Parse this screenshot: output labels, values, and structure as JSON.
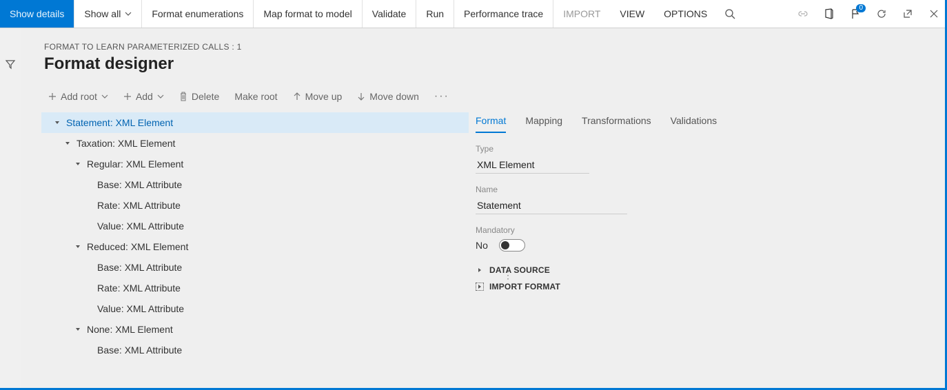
{
  "menubar": {
    "show_details": "Show details",
    "show_all": "Show all",
    "format_enum": "Format enumerations",
    "map_format": "Map format to model",
    "validate": "Validate",
    "run": "Run",
    "perf_trace": "Performance trace",
    "import": "IMPORT",
    "view": "VIEW",
    "options": "OPTIONS",
    "badge_count": "0"
  },
  "breadcrumb": "FORMAT TO LEARN PARAMETERIZED CALLS : 1",
  "page_title": "Format designer",
  "toolbar": {
    "add_root": "Add root",
    "add": "Add",
    "delete": "Delete",
    "make_root": "Make root",
    "move_up": "Move up",
    "move_down": "Move down"
  },
  "tree": [
    {
      "level": 0,
      "expanded": true,
      "selected": true,
      "label": "Statement: XML Element"
    },
    {
      "level": 1,
      "expanded": true,
      "selected": false,
      "label": "Taxation: XML Element"
    },
    {
      "level": 2,
      "expanded": true,
      "selected": false,
      "label": "Regular: XML Element"
    },
    {
      "level": 3,
      "expanded": false,
      "selected": false,
      "label": "Base: XML Attribute"
    },
    {
      "level": 3,
      "expanded": false,
      "selected": false,
      "label": "Rate: XML Attribute"
    },
    {
      "level": 3,
      "expanded": false,
      "selected": false,
      "label": "Value: XML Attribute"
    },
    {
      "level": 2,
      "expanded": true,
      "selected": false,
      "label": "Reduced: XML Element"
    },
    {
      "level": 3,
      "expanded": false,
      "selected": false,
      "label": "Base: XML Attribute"
    },
    {
      "level": 3,
      "expanded": false,
      "selected": false,
      "label": "Rate: XML Attribute"
    },
    {
      "level": 3,
      "expanded": false,
      "selected": false,
      "label": "Value: XML Attribute"
    },
    {
      "level": 2,
      "expanded": true,
      "selected": false,
      "label": "None: XML Element"
    },
    {
      "level": 3,
      "expanded": false,
      "selected": false,
      "label": "Base: XML Attribute"
    }
  ],
  "tabs": {
    "format": "Format",
    "mapping": "Mapping",
    "transformations": "Transformations",
    "validations": "Validations"
  },
  "props": {
    "type_label": "Type",
    "type_value": "XML Element",
    "name_label": "Name",
    "name_value": "Statement",
    "mandatory_label": "Mandatory",
    "mandatory_value": "No",
    "data_source": "DATA SOURCE",
    "import_format": "IMPORT FORMAT"
  }
}
